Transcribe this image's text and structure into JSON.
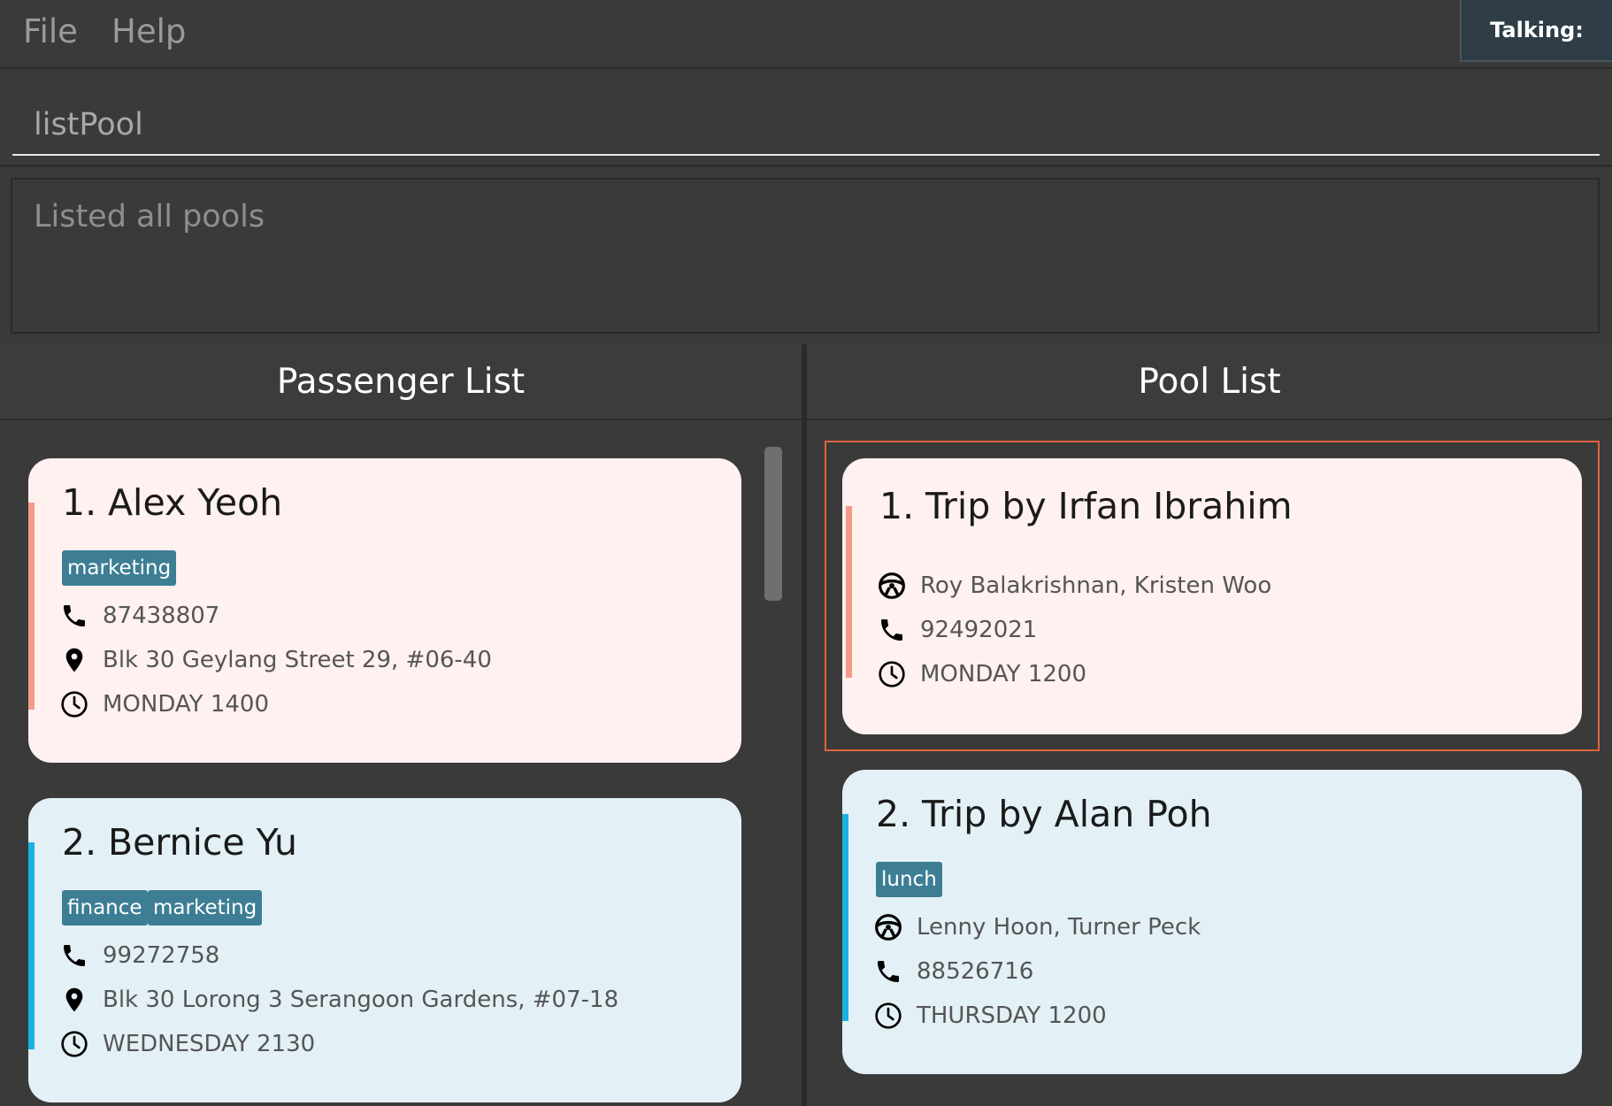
{
  "menu": {
    "file": "File",
    "help": "Help"
  },
  "status": {
    "talking": "Talking:"
  },
  "command": {
    "value": "listPool"
  },
  "result": {
    "text": "Listed all pools"
  },
  "panels": {
    "passenger_title": "Passenger List",
    "pool_title": "Pool List"
  },
  "passengers": [
    {
      "index": "1.",
      "name": "Alex Yeoh",
      "tags": [
        "marketing"
      ],
      "phone": "87438807",
      "address": "Blk 30 Geylang Street 29, #06-40",
      "time": "MONDAY 1400",
      "accent_color": "#f49b88"
    },
    {
      "index": "2.",
      "name": "Bernice Yu",
      "tags": [
        "finance",
        "marketing"
      ],
      "phone": "99272758",
      "address": "Blk 30 Lorong 3 Serangoon Gardens, #07-18",
      "time": "WEDNESDAY 2130",
      "accent_color": "#1ab2e0"
    }
  ],
  "pools": [
    {
      "index": "1.",
      "title": "Trip by Irfan Ibrahim",
      "tags": [],
      "passengers": "Roy Balakrishnan, Kristen Woo",
      "phone": "92492021",
      "time": "MONDAY 1200",
      "selected": true
    },
    {
      "index": "2.",
      "title": "Trip by Alan Poh",
      "tags": [
        "lunch"
      ],
      "passengers": "Lenny Hoon, Turner Peck",
      "phone": "88526716",
      "time": "THURSDAY 1200",
      "selected": false
    }
  ],
  "icons": {
    "phone": "phone-icon",
    "location": "location-pin-icon",
    "clock": "clock-icon",
    "driver": "steering-wheel-icon"
  },
  "colors": {
    "background": "#3a3a3a",
    "pink_card": "#fff1ef",
    "blue_card": "#e3f1f6",
    "tag": "#3d7e94",
    "selection": "#e0643f"
  }
}
